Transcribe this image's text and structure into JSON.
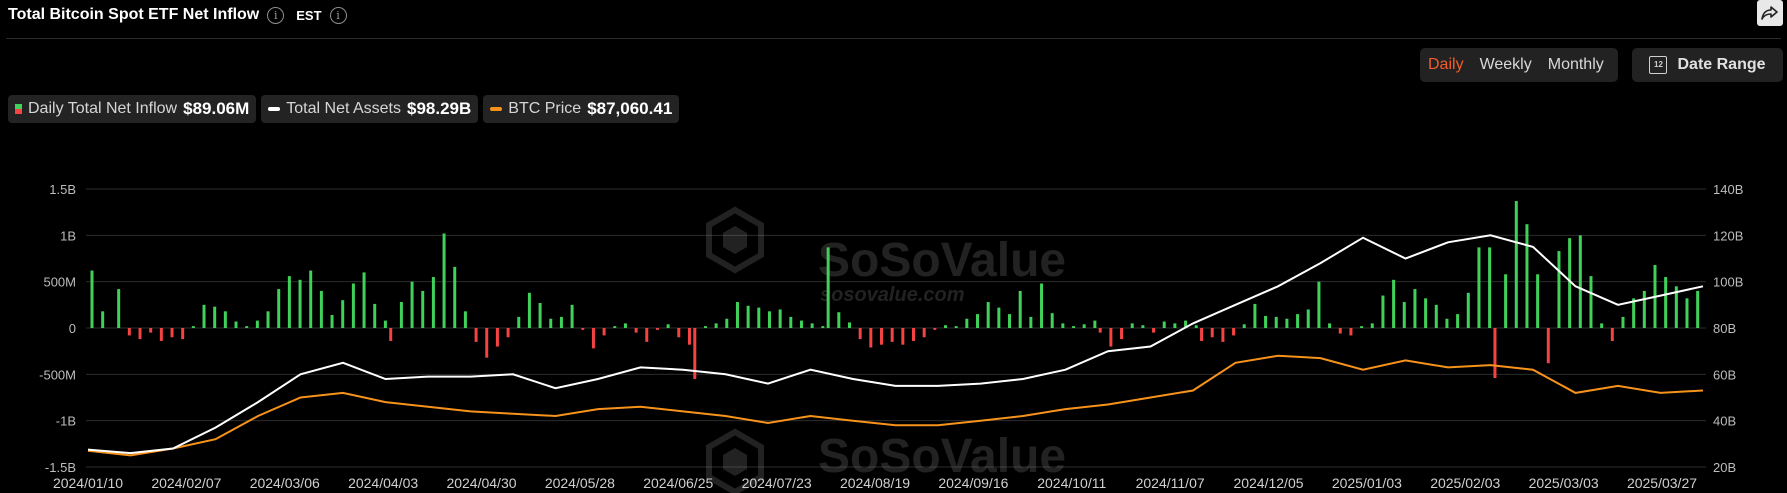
{
  "header": {
    "title": "Total Bitcoin Spot ETF Net Inflow",
    "timezone": "EST"
  },
  "periods": {
    "daily": "Daily",
    "weekly": "Weekly",
    "monthly": "Monthly",
    "active": "Daily"
  },
  "date_range_label": "Date Range",
  "calendar_glyph": "12",
  "watermark": {
    "brand": "SoSoValue",
    "site": "sosovalue.com"
  },
  "legend": {
    "inflow": {
      "label": "Daily Total Net Inflow",
      "value": "$89.06M"
    },
    "assets": {
      "label": "Total Net Assets",
      "value": "$98.29B"
    },
    "btc": {
      "label": "BTC Price",
      "value": "$87,060.41"
    }
  },
  "colors": {
    "positive": "#3fd159",
    "negative": "#f44343",
    "assets_line": "#ffffff",
    "btc_line": "#f7931a",
    "accent": "#f25c2a",
    "grid": "#2c2c2c"
  },
  "chart_data": {
    "type": "bar",
    "left_axis": {
      "ticks": [
        "1.5B",
        "1B",
        "500M",
        "0",
        "-500M",
        "-1B",
        "-1.5B"
      ],
      "ylim": [
        -1.5,
        1.5
      ],
      "unit": "B"
    },
    "right_axis": {
      "ticks": [
        "140B",
        "120B",
        "100B",
        "80B",
        "60B",
        "40B",
        "20B"
      ],
      "ylim": [
        20,
        140
      ],
      "unit": "B"
    },
    "x_ticks": [
      "2024/01/10",
      "2024/02/07",
      "2024/03/06",
      "2024/04/03",
      "2024/04/30",
      "2024/05/28",
      "2024/06/25",
      "2024/07/23",
      "2024/08/19",
      "2024/09/16",
      "2024/10/11",
      "2024/11/07",
      "2024/12/05",
      "2025/01/03",
      "2025/02/03",
      "2025/03/03",
      "2025/03/27"
    ],
    "bar_count": 303,
    "net_inflow_series": [
      [
        0,
        0.62
      ],
      [
        2,
        0.18
      ],
      [
        5,
        0.42
      ],
      [
        7,
        -0.08
      ],
      [
        9,
        -0.12
      ],
      [
        11,
        -0.05
      ],
      [
        13,
        -0.14
      ],
      [
        15,
        -0.1
      ],
      [
        17,
        -0.12
      ],
      [
        19,
        0.02
      ],
      [
        21,
        0.25
      ],
      [
        23,
        0.23
      ],
      [
        25,
        0.18
      ],
      [
        27,
        0.07
      ],
      [
        29,
        0.02
      ],
      [
        31,
        0.08
      ],
      [
        33,
        0.18
      ],
      [
        35,
        0.42
      ],
      [
        37,
        0.56
      ],
      [
        39,
        0.52
      ],
      [
        41,
        0.62
      ],
      [
        43,
        0.4
      ],
      [
        45,
        0.14
      ],
      [
        47,
        0.3
      ],
      [
        49,
        0.48
      ],
      [
        51,
        0.6
      ],
      [
        53,
        0.26
      ],
      [
        55,
        0.08
      ],
      [
        56,
        -0.14
      ],
      [
        58,
        0.28
      ],
      [
        60,
        0.5
      ],
      [
        62,
        0.4
      ],
      [
        64,
        0.55
      ],
      [
        66,
        1.02
      ],
      [
        68,
        0.66
      ],
      [
        70,
        0.18
      ],
      [
        72,
        -0.15
      ],
      [
        74,
        -0.32
      ],
      [
        76,
        -0.2
      ],
      [
        78,
        -0.1
      ],
      [
        80,
        0.12
      ],
      [
        82,
        0.38
      ],
      [
        84,
        0.27
      ],
      [
        86,
        0.1
      ],
      [
        88,
        0.12
      ],
      [
        90,
        0.25
      ],
      [
        92,
        -0.02
      ],
      [
        94,
        -0.22
      ],
      [
        96,
        -0.08
      ],
      [
        98,
        0.02
      ],
      [
        100,
        0.05
      ],
      [
        102,
        -0.05
      ],
      [
        104,
        -0.15
      ],
      [
        106,
        -0.02
      ],
      [
        108,
        0.04
      ],
      [
        110,
        -0.1
      ],
      [
        112,
        -0.18
      ],
      [
        113,
        -0.55
      ],
      [
        115,
        0.02
      ],
      [
        117,
        0.05
      ],
      [
        119,
        0.1
      ],
      [
        121,
        0.28
      ],
      [
        123,
        0.24
      ],
      [
        125,
        0.22
      ],
      [
        127,
        0.18
      ],
      [
        129,
        0.2
      ],
      [
        131,
        0.12
      ],
      [
        133,
        0.08
      ],
      [
        135,
        0.05
      ],
      [
        137,
        0.02
      ],
      [
        138,
        0.87
      ],
      [
        140,
        0.17
      ],
      [
        142,
        0.06
      ],
      [
        144,
        -0.12
      ],
      [
        146,
        -0.21
      ],
      [
        148,
        -0.18
      ],
      [
        150,
        -0.15
      ],
      [
        152,
        -0.18
      ],
      [
        154,
        -0.14
      ],
      [
        156,
        -0.1
      ],
      [
        158,
        -0.02
      ],
      [
        160,
        0.03
      ],
      [
        162,
        0.02
      ],
      [
        164,
        0.1
      ],
      [
        166,
        0.15
      ],
      [
        168,
        0.28
      ],
      [
        170,
        0.22
      ],
      [
        172,
        0.15
      ],
      [
        174,
        0.4
      ],
      [
        176,
        0.12
      ],
      [
        178,
        0.48
      ],
      [
        180,
        0.16
      ],
      [
        182,
        0.05
      ],
      [
        184,
        0.02
      ],
      [
        186,
        0.04
      ],
      [
        188,
        0.08
      ],
      [
        189,
        -0.05
      ],
      [
        191,
        -0.2
      ],
      [
        193,
        -0.12
      ],
      [
        195,
        0.05
      ],
      [
        197,
        0.03
      ],
      [
        199,
        -0.05
      ],
      [
        201,
        0.07
      ],
      [
        203,
        0.05
      ],
      [
        205,
        0.08
      ],
      [
        207,
        0.03
      ],
      [
        208,
        -0.14
      ],
      [
        210,
        -0.1
      ],
      [
        212,
        -0.15
      ],
      [
        214,
        -0.08
      ],
      [
        216,
        0.04
      ],
      [
        218,
        0.26
      ],
      [
        220,
        0.13
      ],
      [
        222,
        0.12
      ],
      [
        224,
        0.1
      ],
      [
        226,
        0.15
      ],
      [
        228,
        0.2
      ],
      [
        230,
        0.5
      ],
      [
        232,
        0.05
      ],
      [
        234,
        -0.06
      ],
      [
        236,
        -0.08
      ],
      [
        238,
        0.02
      ],
      [
        240,
        0.05
      ],
      [
        242,
        0.35
      ],
      [
        244,
        0.52
      ],
      [
        246,
        0.28
      ],
      [
        248,
        0.42
      ],
      [
        250,
        0.32
      ],
      [
        252,
        0.25
      ],
      [
        254,
        0.1
      ],
      [
        256,
        0.15
      ],
      [
        258,
        0.38
      ],
      [
        260,
        0.87
      ],
      [
        262,
        0.87
      ],
      [
        263,
        -0.54
      ],
      [
        265,
        0.58
      ],
      [
        267,
        1.37
      ],
      [
        269,
        1.12
      ],
      [
        271,
        0.58
      ],
      [
        273,
        -0.38
      ],
      [
        275,
        0.83
      ],
      [
        277,
        0.97
      ],
      [
        279,
        1.0
      ],
      [
        281,
        0.56
      ],
      [
        283,
        0.05
      ],
      [
        285,
        -0.14
      ],
      [
        287,
        0.12
      ],
      [
        289,
        0.32
      ],
      [
        291,
        0.4
      ],
      [
        293,
        0.68
      ],
      [
        295,
        0.55
      ],
      [
        297,
        0.45
      ],
      [
        299,
        0.32
      ],
      [
        301,
        0.4
      ]
    ],
    "total_net_assets_series": [
      [
        0,
        27.5
      ],
      [
        10,
        26
      ],
      [
        20,
        28
      ],
      [
        30,
        37
      ],
      [
        40,
        48
      ],
      [
        50,
        60
      ],
      [
        60,
        65
      ],
      [
        70,
        58
      ],
      [
        80,
        59
      ],
      [
        90,
        59
      ],
      [
        100,
        60
      ],
      [
        110,
        54
      ],
      [
        120,
        58
      ],
      [
        130,
        63
      ],
      [
        140,
        62
      ],
      [
        150,
        60
      ],
      [
        160,
        56
      ],
      [
        170,
        62
      ],
      [
        180,
        58
      ],
      [
        190,
        55
      ],
      [
        200,
        55
      ],
      [
        210,
        56
      ],
      [
        220,
        58
      ],
      [
        230,
        62
      ],
      [
        240,
        70
      ],
      [
        250,
        72
      ],
      [
        260,
        82
      ],
      [
        270,
        90
      ],
      [
        280,
        98
      ],
      [
        290,
        108
      ],
      [
        300,
        119
      ],
      [
        310,
        110
      ],
      [
        320,
        117
      ],
      [
        330,
        120
      ],
      [
        340,
        115
      ],
      [
        350,
        98
      ],
      [
        360,
        90
      ],
      [
        370,
        94
      ],
      [
        380,
        98
      ]
    ],
    "btc_price_series": [
      [
        0,
        27
      ],
      [
        10,
        25
      ],
      [
        20,
        28
      ],
      [
        30,
        32
      ],
      [
        40,
        42
      ],
      [
        50,
        50
      ],
      [
        60,
        52
      ],
      [
        70,
        48
      ],
      [
        80,
        46
      ],
      [
        90,
        44
      ],
      [
        100,
        43
      ],
      [
        110,
        42
      ],
      [
        120,
        45
      ],
      [
        130,
        46
      ],
      [
        140,
        44
      ],
      [
        150,
        42
      ],
      [
        160,
        39
      ],
      [
        170,
        42
      ],
      [
        180,
        40
      ],
      [
        190,
        38
      ],
      [
        200,
        38
      ],
      [
        210,
        40
      ],
      [
        220,
        42
      ],
      [
        230,
        45
      ],
      [
        240,
        47
      ],
      [
        250,
        50
      ],
      [
        260,
        53
      ],
      [
        270,
        65
      ],
      [
        280,
        68
      ],
      [
        290,
        67
      ],
      [
        300,
        62
      ],
      [
        310,
        66
      ],
      [
        320,
        63
      ],
      [
        330,
        64
      ],
      [
        340,
        62
      ],
      [
        350,
        52
      ],
      [
        360,
        55
      ],
      [
        370,
        52
      ],
      [
        380,
        53
      ]
    ]
  }
}
